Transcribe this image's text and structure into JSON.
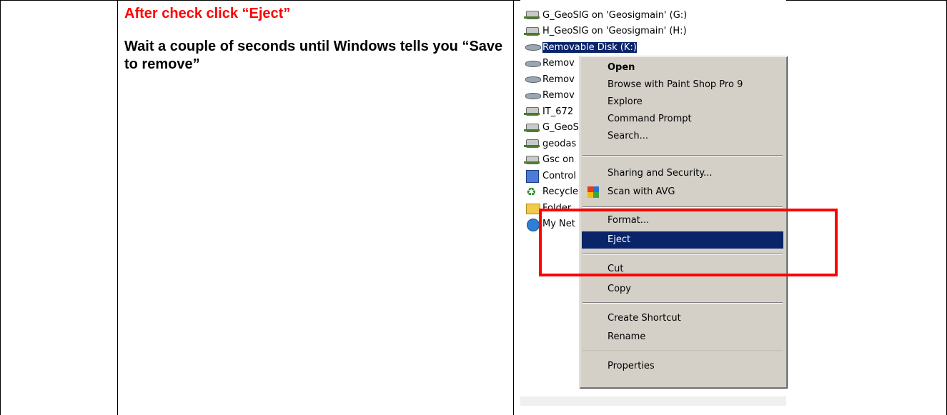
{
  "instructions": {
    "step_title": "After check click “Eject”",
    "step_description": "Wait a couple of seconds until Windows tells you “Save to remove”"
  },
  "explorer": {
    "items": [
      {
        "label": "G_GeoSIG on 'Geosigmain' (G:)",
        "type": "N",
        "icon": "network-drive-icon"
      },
      {
        "label": "H_GeoSIG on 'Geosigmain' (H:)",
        "type": "N",
        "icon": "network-drive-icon"
      },
      {
        "label": "Removable Disk (K:)",
        "type": "R",
        "icon": "removable-disk-icon",
        "selected": true
      },
      {
        "label": "Remov",
        "type": "R",
        "icon": "removable-disk-icon"
      },
      {
        "label": "Remov",
        "type": "R",
        "icon": "removable-disk-icon"
      },
      {
        "label": "Remov",
        "type": "R",
        "icon": "removable-disk-icon"
      },
      {
        "label": "IT_672",
        "type": "D",
        "icon": "network-drive-icon"
      },
      {
        "label": "G_GeoS",
        "type": "N",
        "icon": "network-drive-icon"
      },
      {
        "label": "geodas",
        "type": "D",
        "icon": "network-drive-icon"
      },
      {
        "label": "Gsc on",
        "type": "N",
        "icon": "network-drive-icon"
      },
      {
        "label": "Control",
        "type": "S",
        "icon": "control-panel-icon"
      },
      {
        "label": "Recycle",
        "type": "S",
        "icon": "recycle-bin-icon"
      },
      {
        "label": "Folder",
        "type": "S",
        "icon": "folder-icon"
      },
      {
        "label": "My Net",
        "type": "S",
        "icon": "network-places-icon"
      }
    ]
  },
  "context_menu": {
    "items": [
      {
        "label": "Open",
        "bold": true
      },
      {
        "label": "Browse with Paint Shop Pro 9"
      },
      {
        "label": "Explore"
      },
      {
        "label": "Command Prompt"
      },
      {
        "label": "Search..."
      },
      {
        "label": "Sharing and Security..."
      },
      {
        "label": "Scan with AVG",
        "icon": "avg-icon"
      },
      {
        "label": "Format..."
      },
      {
        "label": "Eject",
        "highlighted": true
      },
      {
        "label": "Cut"
      },
      {
        "label": "Copy"
      },
      {
        "label": "Create Shortcut"
      },
      {
        "label": "Rename"
      },
      {
        "label": "Properties"
      }
    ]
  },
  "colors": {
    "callout": "#ff0000",
    "selection": "#0a246a",
    "menu_bg": "#d4d0c8"
  }
}
